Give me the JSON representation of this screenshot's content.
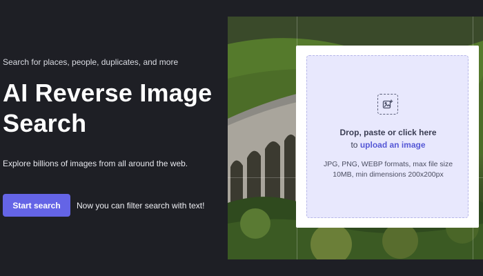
{
  "hero": {
    "tagline": "Search for places, people, duplicates, and more",
    "headline": "AI Reverse Image Search",
    "subtext": "Explore billions of images from all around the web.",
    "start_button": "Start search",
    "filter_note": "Now you can filter search with text!"
  },
  "upload": {
    "prompt": "Drop, paste or click here",
    "prompt_prefix": "to",
    "link_label": "upload an image",
    "formats": "JPG, PNG, WEBP formats, max file size 10MB, min dimensions 200x200px",
    "icon": "image-upload-icon"
  },
  "colors": {
    "background": "#1e1f25",
    "accent": "#6464e6",
    "dropzone": "#e8e8fd",
    "link": "#5558d6"
  }
}
